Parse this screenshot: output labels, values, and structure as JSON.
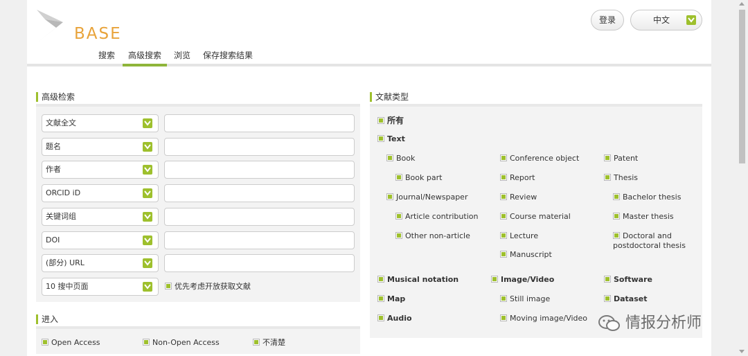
{
  "header": {
    "logo_text": "BASE",
    "login_label": "登录",
    "language": "中文"
  },
  "nav": {
    "items": [
      {
        "label": "搜索"
      },
      {
        "label": "高级搜索",
        "active": true
      },
      {
        "label": "浏览"
      },
      {
        "label": "保存搜索结果"
      }
    ]
  },
  "advanced": {
    "title": "高级检索",
    "rows": [
      {
        "field": "文献全文",
        "value": ""
      },
      {
        "field": "题名",
        "value": ""
      },
      {
        "field": "作者",
        "value": ""
      },
      {
        "field": "ORCID iD",
        "value": ""
      },
      {
        "field": "关键词组",
        "value": ""
      },
      {
        "field": "DOI",
        "value": ""
      },
      {
        "field": "(部分) URL",
        "value": ""
      }
    ],
    "per_page": "10 搜中页面",
    "open_access_pref": "优先考虑开放获取文献"
  },
  "access": {
    "title": "进入",
    "options": [
      "Open Access",
      "Non-Open Access",
      "不清楚"
    ]
  },
  "doctype": {
    "title": "文献类型",
    "all": "所有",
    "text": "Text",
    "book": "Book",
    "book_part": "Book part",
    "journal": "Journal/Newspaper",
    "article_contribution": "Article contribution",
    "other_non_article": "Other non-article",
    "conference_object": "Conference object",
    "report": "Report",
    "review": "Review",
    "course_material": "Course material",
    "lecture": "Lecture",
    "manuscript": "Manuscript",
    "patent": "Patent",
    "thesis": "Thesis",
    "bachelor_thesis": "Bachelor thesis",
    "master_thesis": "Master thesis",
    "doctoral_thesis_1": "Doctoral and",
    "doctoral_thesis_2": "postdoctoral thesis",
    "musical_notation": "Musical notation",
    "map": "Map",
    "audio": "Audio",
    "image_video": "Image/Video",
    "still_image": "Still image",
    "moving_image": "Moving image/Video",
    "software": "Software",
    "dataset": "Dataset"
  },
  "watermark": "情报分析师",
  "colors": {
    "accent": "#9ec02d",
    "logo": "#e8a33a",
    "nav_underline": "#8fb53a"
  }
}
